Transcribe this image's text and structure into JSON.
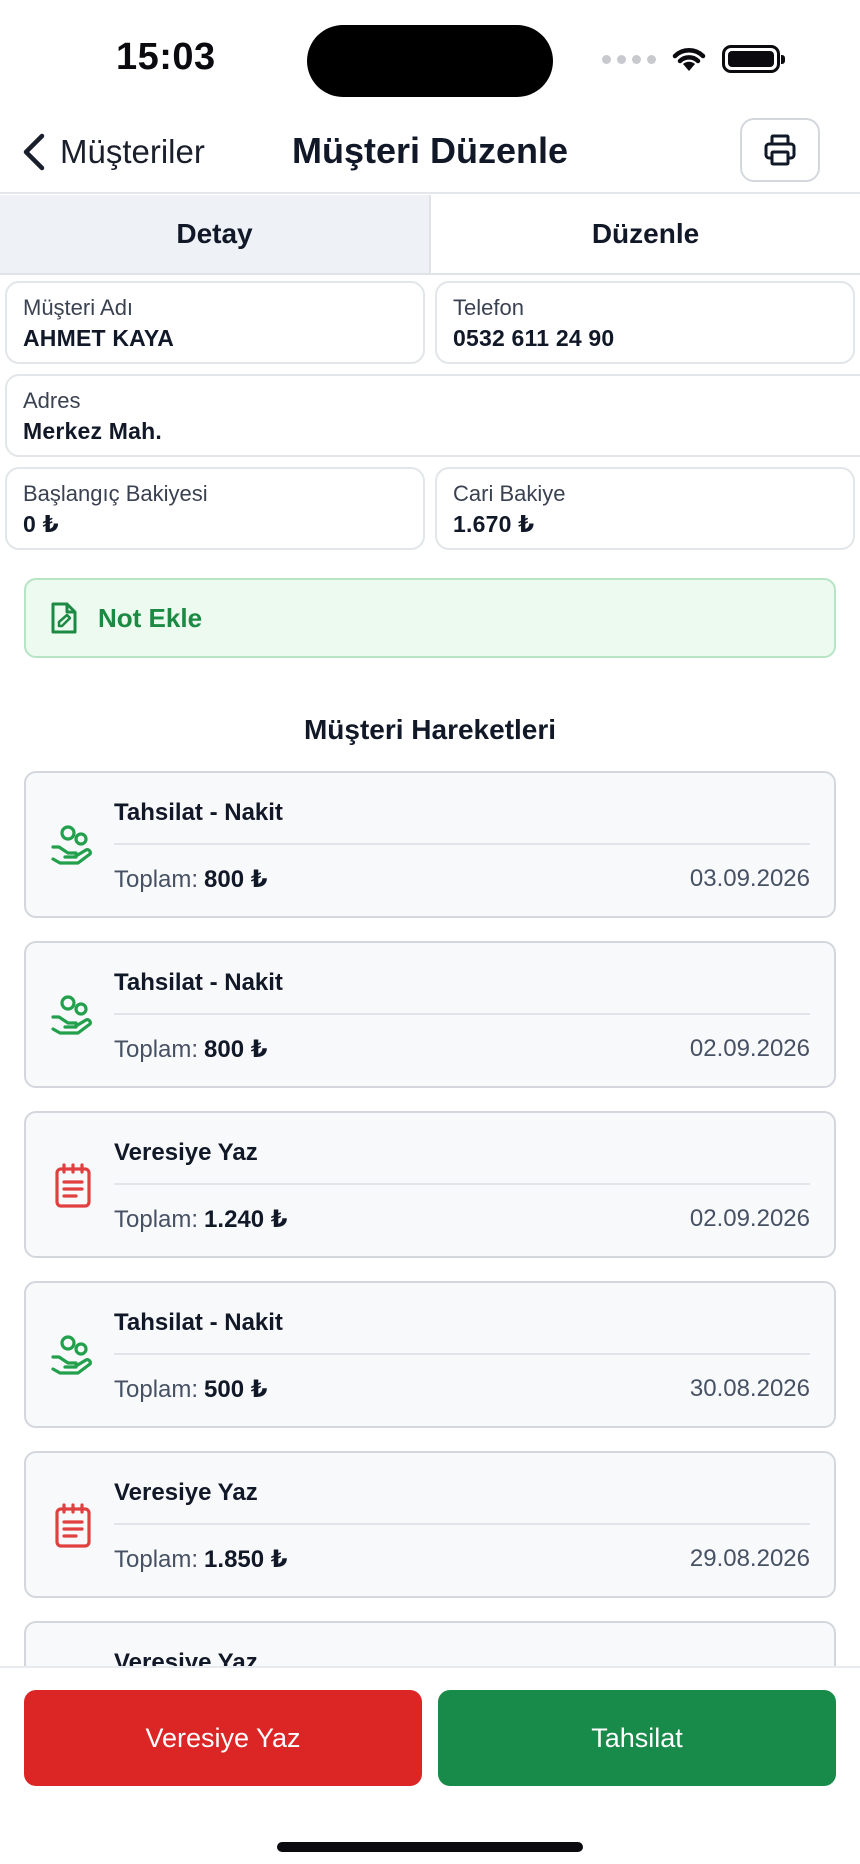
{
  "status_bar": {
    "time": "15:03"
  },
  "nav": {
    "back_label": "Müşteriler",
    "title": "Müşteri Düzenle",
    "print_icon": "printer-icon"
  },
  "tabs": [
    {
      "label": "Detay",
      "active": true
    },
    {
      "label": "Düzenle",
      "active": false
    }
  ],
  "customer": {
    "name_label": "Müşteri Adı",
    "name": "AHMET KAYA",
    "phone_label": "Telefon",
    "phone": "0532 611 24 90",
    "address_label": "Adres",
    "address": "Merkez Mah.",
    "opening_balance_label": "Başlangıç Bakiyesi",
    "opening_balance": "0 ₺",
    "current_balance_label": "Cari Bakiye",
    "current_balance": "1.670 ₺"
  },
  "note": {
    "label": "Not Ekle",
    "icon": "note-edit-icon"
  },
  "transactions_title": "Müşteri Hareketleri",
  "transactions": [
    {
      "type": "payment",
      "title": "Tahsilat - Nakit",
      "total_label": "Toplam:",
      "total": "800 ₺",
      "date": "03.09.2026"
    },
    {
      "type": "payment",
      "title": "Tahsilat - Nakit",
      "total_label": "Toplam:",
      "total": "800 ₺",
      "date": "02.09.2026"
    },
    {
      "type": "credit",
      "title": "Veresiye Yaz",
      "total_label": "Toplam:",
      "total": "1.240 ₺",
      "date": "02.09.2026"
    },
    {
      "type": "payment",
      "title": "Tahsilat - Nakit",
      "total_label": "Toplam:",
      "total": "500 ₺",
      "date": "30.08.2026"
    },
    {
      "type": "credit",
      "title": "Veresiye Yaz",
      "total_label": "Toplam:",
      "total": "1.850 ₺",
      "date": "29.08.2026"
    },
    {
      "type": "credit",
      "title": "Veresiye Yaz",
      "total_label": "",
      "total": "",
      "date": ""
    }
  ],
  "actions": {
    "credit_label": "Veresiye Yaz",
    "payment_label": "Tahsilat"
  },
  "colors": {
    "accent_green": "#188a49",
    "accent_red": "#dc2626",
    "payment_icon": "#22a04b",
    "credit_icon": "#e0403f"
  }
}
